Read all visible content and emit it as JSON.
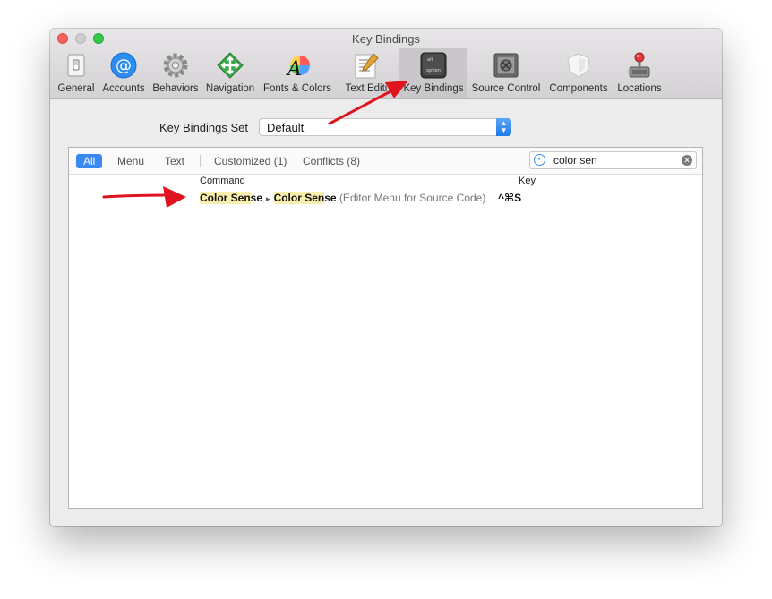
{
  "window": {
    "title": "Key Bindings"
  },
  "toolbar": {
    "items": [
      {
        "label": "General",
        "icon": "switch-icon"
      },
      {
        "label": "Accounts",
        "icon": "at-sign-icon"
      },
      {
        "label": "Behaviors",
        "icon": "gear-icon"
      },
      {
        "label": "Navigation",
        "icon": "move-arrows-icon"
      },
      {
        "label": "Fonts & Colors",
        "icon": "font-color-icon"
      },
      {
        "label": "Text Editi",
        "icon": "text-editing-icon"
      },
      {
        "label": "Key Bindings",
        "icon": "option-key-icon",
        "selected": true
      },
      {
        "label": "Source Control",
        "icon": "vault-icon"
      },
      {
        "label": "Components",
        "icon": "shield-icon"
      },
      {
        "label": "Locations",
        "icon": "joystick-icon"
      }
    ]
  },
  "key_bindings_set": {
    "label": "Key Bindings Set",
    "value": "Default"
  },
  "filter": {
    "scopes": [
      "All",
      "Menu",
      "Text",
      "Customized (1)",
      "Conflicts (8)"
    ],
    "active_scope": "All",
    "search_value": "color sen"
  },
  "table": {
    "columns": [
      "Command",
      "Key"
    ],
    "rows": [
      {
        "path": [
          "Color Sense",
          "Color Sense"
        ],
        "match_part": "Color Sen",
        "rest_part": "se",
        "context": "(Editor Menu for Source Code)",
        "key": "^⌘S"
      }
    ]
  },
  "option_key": {
    "top": "alt",
    "bottom": "option"
  },
  "colors": {
    "accent": "#3b88f3",
    "highlight": "#fbefb0",
    "annotation_arrow": "#e0141e"
  }
}
